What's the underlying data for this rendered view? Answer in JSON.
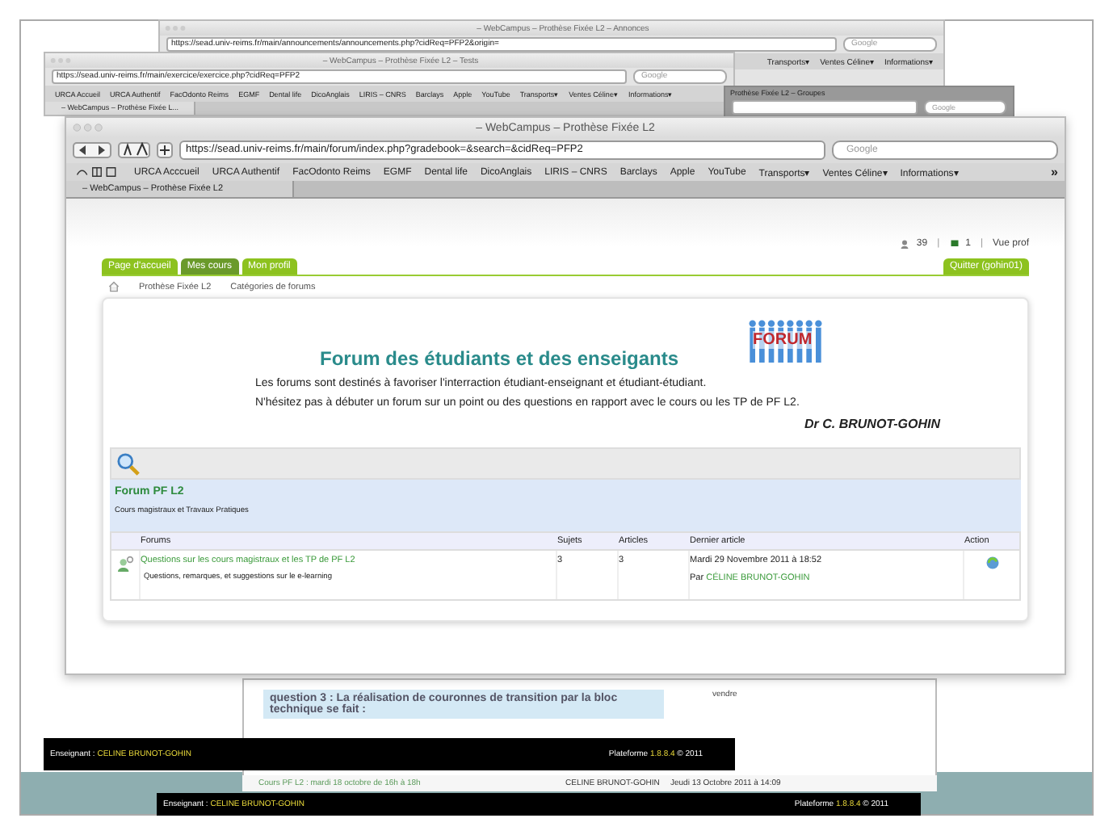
{
  "back_windows": [
    {
      "title": "– WebCampus – Prothèse Fixée L2 – Annonces",
      "url": "https://sead.univ-reims.fr/main/announcements/announcements.php?cidReq=PFP2&origin=",
      "search_placeholder": "Google",
      "bookmarks": [
        "Transports▾",
        "Ventes Céline▾",
        "Informations▾"
      ]
    },
    {
      "title": "– WebCampus – Prothèse Fixée L2 – Tests",
      "url": "https://sead.univ-reims.fr/main/exercice/exercice.php?cidReq=PFP2",
      "search_placeholder": "Google",
      "bookmarks": [
        "URCA Accueil",
        "URCA Authentif",
        "FacOdonto Reims",
        "EGMF",
        "Dental life",
        "DicoAnglais",
        "LIRIS – CNRS",
        "Barclays",
        "Apple",
        "YouTube",
        "Transports▾",
        "Ventes Céline▾",
        "Informations▾"
      ],
      "tab": "– WebCampus – Prothèse Fixée L..."
    },
    {
      "title": "Prothèse Fixée L2 – Groupes",
      "search_placeholder": "Google"
    }
  ],
  "main_window": {
    "title": "– WebCampus – Prothèse Fixée L2",
    "url": "https://sead.univ-reims.fr/main/forum/index.php?gradebook=&search=&cidReq=PFP2",
    "search_placeholder": "Google",
    "bookmarks": [
      "URCA Acccueil",
      "URCA Authentif",
      "FacOdonto Reims",
      "EGMF",
      "Dental life",
      "DicoAnglais",
      "LIRIS – CNRS",
      "Barclays",
      "Apple",
      "YouTube",
      "Transports▾",
      "Ventes Céline▾",
      "Informations▾"
    ],
    "overflow": "»",
    "tab": "– WebCampus – Prothèse Fixée L2"
  },
  "page": {
    "stats": {
      "users": "39",
      "separator": "|",
      "messages": "1",
      "separator_2": "|",
      "view": "Vue prof"
    },
    "nav": [
      {
        "label": "Page d'accueil",
        "selected": false
      },
      {
        "label": "Mes cours",
        "selected": true
      },
      {
        "label": "Mon profil",
        "selected": false
      }
    ],
    "logout": "Quitter (gohin01)",
    "breadcrumb": [
      "Prothèse Fixée L2",
      "Catégories de forums"
    ],
    "logo_text": "FORUM",
    "heading": "Forum des étudiants et des enseigants",
    "intro": [
      "Les forums sont destinés à favoriser l'interraction étudiant-enseignant et étudiant-étudiant.",
      "N'hésitez pas à débuter un forum sur un point ou des questions en rapport avec le cours ou les TP de PF L2."
    ],
    "signature": "Dr C. BRUNOT-GOHIN",
    "category": {
      "title": "Forum PF L2",
      "description": "Cours magistraux et Travaux Pratiques"
    },
    "columns": [
      "Forums",
      "Sujets",
      "Articles",
      "Dernier article",
      "Action"
    ],
    "rows": [
      {
        "title": "Questions sur les cours magistraux et les TP de PF L2",
        "description": "Questions, remarques, et suggestions sur le e-learning",
        "topics": "3",
        "posts": "3",
        "last_date": "Mardi 29 Novembre 2011 à 18:52",
        "last_by_label": "Par",
        "last_by": "CÉLINE BRUNOT-GOHIN"
      }
    ]
  },
  "background_fragments": {
    "question": "question 3 : La réalisation de couronnes de transition par la bloc technique se fait :",
    "side_text": "vendre",
    "listing_row": {
      "title": "Cours PF L2 : mardi 18 octobre de 16h à 18h",
      "author": "CELINE BRUNOT-GOHIN",
      "date": "Jeudi 13 Octobre 2011 à 14:09"
    },
    "footers": [
      {
        "teacher_label": "Enseignant :",
        "teacher": "CELINE BRUNOT-GOHIN",
        "platform_label": "Plateforme",
        "version": "1.8.8.4",
        "copyright": "© 2011"
      },
      {
        "teacher_label": "Enseignant :",
        "teacher": "CELINE BRUNOT-GOHIN",
        "platform_label": "Plateforme",
        "version": "1.8.8.4",
        "copyright": "© 2011"
      }
    ]
  }
}
